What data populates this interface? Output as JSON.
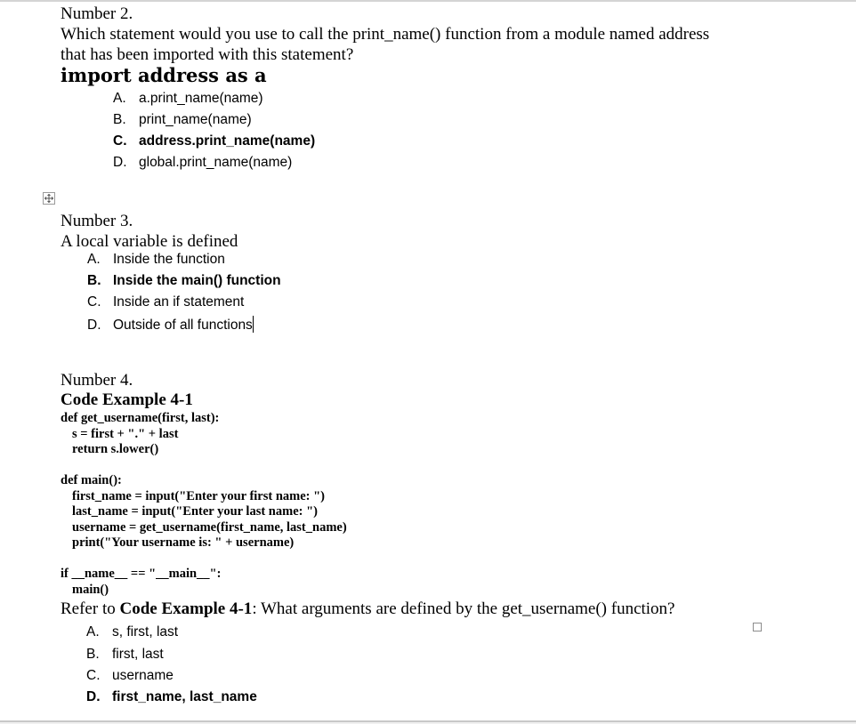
{
  "questions": [
    {
      "number_label": "Number 2.",
      "prompt_lines": [
        "Which statement would you use to call the print_name() function from a module named address",
        "that has been imported with this statement?"
      ],
      "statement": "import address as a",
      "options": [
        {
          "letter": "A.",
          "text": "a.print_name(name)",
          "selected": false
        },
        {
          "letter": "B.",
          "text": "print_name(name)",
          "selected": false
        },
        {
          "letter": "C.",
          "text": "address.print_name(name)",
          "selected": true
        },
        {
          "letter": "D.",
          "text": "global.print_name(name)",
          "selected": false
        }
      ]
    },
    {
      "number_label": "Number 3.",
      "prompt": "A local variable is defined",
      "options": [
        {
          "letter": "A.",
          "text": "Inside the function",
          "selected": false
        },
        {
          "letter": "B.",
          "text": "Inside the main() function",
          "selected": true
        },
        {
          "letter": "C.",
          "text": "Inside an if statement",
          "selected": false
        },
        {
          "letter": "D.",
          "text": "Outside of all functions",
          "selected": false
        }
      ]
    },
    {
      "number_label": "Number 4.",
      "code_title": "Code Example 4-1",
      "code_lines": [
        {
          "indent": 0,
          "text": "def get_username(first, last):"
        },
        {
          "indent": 1,
          "text": "s = first + \".\" + last"
        },
        {
          "indent": 1,
          "text": "return s.lower()"
        },
        {
          "indent": 0,
          "text": ""
        },
        {
          "indent": 0,
          "text": "def main():"
        },
        {
          "indent": 1,
          "text": "first_name = input(\"Enter your first name: \")"
        },
        {
          "indent": 1,
          "text": "last_name = input(\"Enter your last name: \")"
        },
        {
          "indent": 1,
          "text": "username = get_username(first_name, last_name)"
        },
        {
          "indent": 1,
          "text": "print(\"Your username is: \" + username)"
        },
        {
          "indent": 0,
          "text": ""
        },
        {
          "indent": 0,
          "text": "if __name__ == \"__main__\":"
        },
        {
          "indent": 1,
          "text": "main()"
        }
      ],
      "prompt_prefix": "Refer to ",
      "prompt_ref": "Code Example 4-1",
      "prompt_suffix": ": What arguments are defined by the get_username() function?",
      "options": [
        {
          "letter": "A.",
          "text": "s, first, last",
          "selected": false
        },
        {
          "letter": "B.",
          "text": "first, last",
          "selected": false
        },
        {
          "letter": "C.",
          "text": "username",
          "selected": false
        },
        {
          "letter": "D.",
          "text": "first_name, last_name",
          "selected": true
        }
      ]
    }
  ],
  "icons": {
    "table_move_handle": "move-arrows-icon",
    "table_resize_handle": "resize-square-icon"
  }
}
